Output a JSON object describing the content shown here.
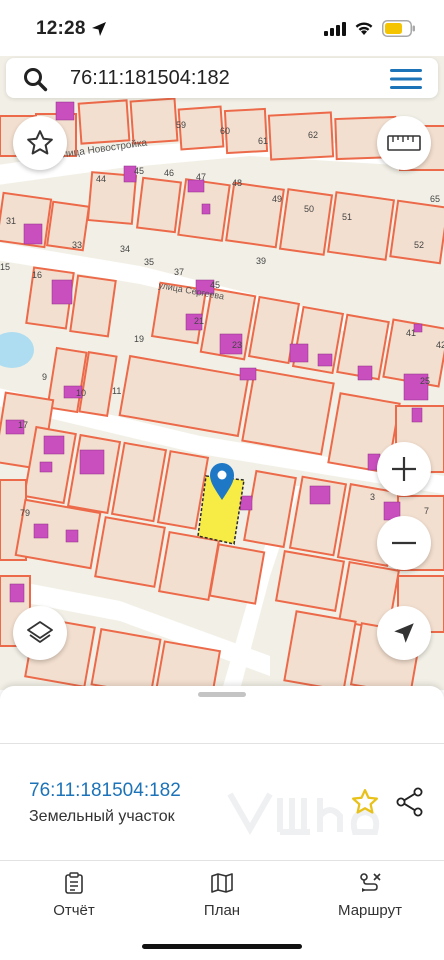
{
  "status_bar": {
    "time": "12:28",
    "icons": [
      "location-arrow-icon",
      "cell-signal-icon",
      "wifi-icon",
      "battery-icon"
    ],
    "battery_color": "#f5c400"
  },
  "search": {
    "query": "76:11:181504:182",
    "menu_icon": "hamburger-menu-icon"
  },
  "map": {
    "colors": {
      "background": "#f2f0e6",
      "parcel_border": "#ec6a4a",
      "parcel_fill": "#f3dfcf",
      "building": "#c94fbf",
      "road": "#ffffff",
      "water": "#aedcf0",
      "selected_parcel": "#f7ec45",
      "marker": "#1f78c6"
    },
    "street_labels": [
      "улица Новостройка",
      "улица Сергеева"
    ],
    "lot_numbers": [
      "59",
      "60",
      "61",
      "62",
      "44",
      "45",
      "46",
      "47",
      "48",
      "49",
      "50",
      "51",
      "65",
      "31",
      "33",
      "34",
      "35",
      "37",
      "39",
      "52",
      "15",
      "16",
      "45",
      "21",
      "19",
      "23",
      "41",
      "42",
      "9",
      "10",
      "11",
      "25",
      "17",
      "3",
      "79",
      "7"
    ],
    "controls": {
      "favorite": "star-icon",
      "ruler": "ruler-icon",
      "zoom_in": "plus-icon",
      "zoom_out": "minus-icon",
      "layers": "layers-icon",
      "locate": "navigate-arrow-icon"
    }
  },
  "sheet": {
    "parcel_id": "76:11:181504:182",
    "parcel_type": "Земельный участок",
    "accent_color": "#1d73b8",
    "star_color": "#e8c21a"
  },
  "tabs": [
    {
      "label": "Отчёт",
      "icon": "report-icon"
    },
    {
      "label": "План",
      "icon": "map-plan-icon"
    },
    {
      "label": "Маршрут",
      "icon": "route-icon"
    }
  ]
}
